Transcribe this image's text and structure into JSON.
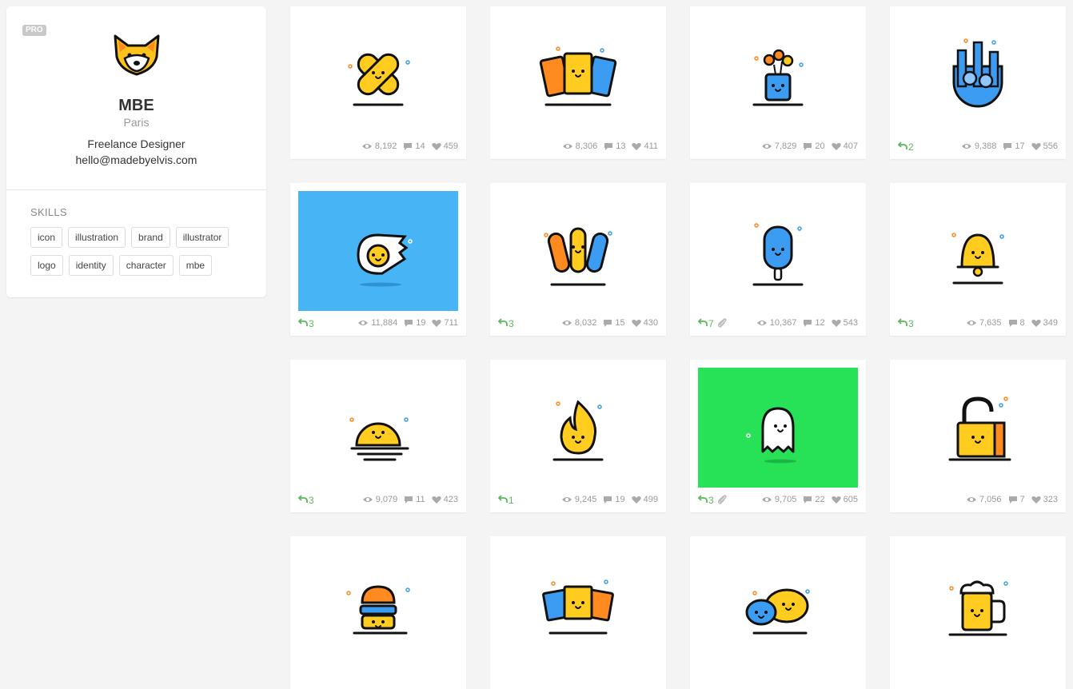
{
  "profile": {
    "badge": "PRO",
    "name": "MBE",
    "location": "Paris",
    "bio": "Freelance Designer",
    "email": "hello@madebyelvis.com",
    "skills_title": "SKILLS",
    "skills": [
      "icon",
      "illustration",
      "brand",
      "illustrator",
      "logo",
      "identity",
      "character",
      "mbe"
    ]
  },
  "colors": {
    "accent_green": "#5cb85c",
    "blue_bg": "#47b4f5",
    "green_bg": "#27e256",
    "yellow": "#ffcc1f",
    "orange": "#ff8a1f",
    "blue": "#3b9cf2"
  },
  "shots": [
    {
      "icon": "bandage-icon",
      "bg": "#ffffff",
      "views": "8,192",
      "comments": "14",
      "likes": "459",
      "rebounds": "",
      "attachment": false
    },
    {
      "icon": "books-icon",
      "bg": "#ffffff",
      "views": "8,306",
      "comments": "13",
      "likes": "411",
      "rebounds": "",
      "attachment": false
    },
    {
      "icon": "flower-vase-icon",
      "bg": "#ffffff",
      "views": "7,829",
      "comments": "20",
      "likes": "407",
      "rebounds": "",
      "attachment": false
    },
    {
      "icon": "city-icon",
      "bg": "#ffffff",
      "views": "9,388",
      "comments": "17",
      "likes": "556",
      "rebounds": "2",
      "attachment": false
    },
    {
      "icon": "egg-icon",
      "bg": "#47b4f5",
      "views": "11,884",
      "comments": "19",
      "likes": "711",
      "rebounds": "3",
      "attachment": false
    },
    {
      "icon": "pencils-icon",
      "bg": "#ffffff",
      "views": "8,032",
      "comments": "15",
      "likes": "430",
      "rebounds": "3",
      "attachment": false
    },
    {
      "icon": "popsicle-icon",
      "bg": "#ffffff",
      "views": "10,367",
      "comments": "12",
      "likes": "543",
      "rebounds": "7",
      "attachment": true
    },
    {
      "icon": "bell-icon",
      "bg": "#ffffff",
      "views": "7,635",
      "comments": "8",
      "likes": "349",
      "rebounds": "3",
      "attachment": false
    },
    {
      "icon": "sun-icon",
      "bg": "#ffffff",
      "views": "9,079",
      "comments": "11",
      "likes": "423",
      "rebounds": "3",
      "attachment": false
    },
    {
      "icon": "fire-icon",
      "bg": "#ffffff",
      "views": "9,245",
      "comments": "19",
      "likes": "499",
      "rebounds": "1",
      "attachment": false
    },
    {
      "icon": "ghost-icon",
      "bg": "#27e256",
      "views": "9,705",
      "comments": "22",
      "likes": "605",
      "rebounds": "3",
      "attachment": true
    },
    {
      "icon": "padlock-icon",
      "bg": "#ffffff",
      "views": "7,056",
      "comments": "7",
      "likes": "323",
      "rebounds": "",
      "attachment": false
    },
    {
      "icon": "burger-icon",
      "bg": "#ffffff",
      "views": "",
      "comments": "",
      "likes": "",
      "rebounds": "",
      "attachment": false
    },
    {
      "icon": "photos-icon",
      "bg": "#ffffff",
      "views": "",
      "comments": "",
      "likes": "",
      "rebounds": "",
      "attachment": false
    },
    {
      "icon": "chat-bubbles-icon",
      "bg": "#ffffff",
      "views": "",
      "comments": "",
      "likes": "",
      "rebounds": "",
      "attachment": false
    },
    {
      "icon": "beer-mug-icon",
      "bg": "#ffffff",
      "views": "",
      "comments": "",
      "likes": "",
      "rebounds": "",
      "attachment": false
    }
  ]
}
